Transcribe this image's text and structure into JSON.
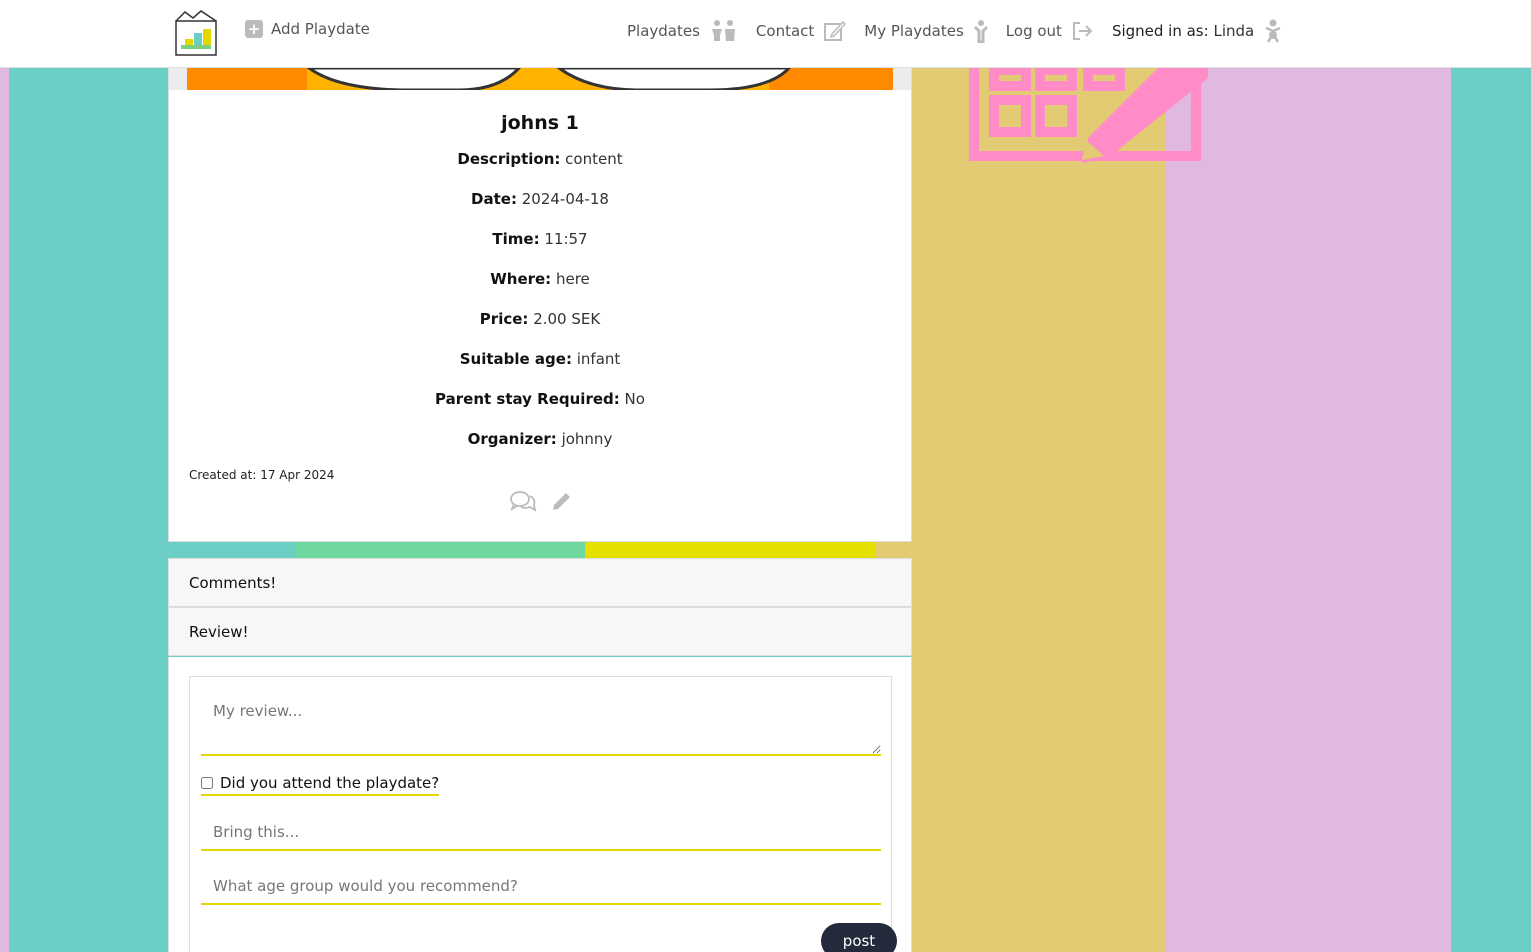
{
  "nav": {
    "add_label": "Add Playdate",
    "items": [
      {
        "label": "Playdates",
        "icon": "children-icon"
      },
      {
        "label": "Contact",
        "icon": "edit-icon"
      },
      {
        "label": "My Playdates",
        "icon": "child-icon"
      },
      {
        "label": "Log out",
        "icon": "logout-icon"
      }
    ],
    "signed_in_prefix": "Signed in as:",
    "signed_in_user": "Linda"
  },
  "playdate": {
    "title": "johns 1",
    "details": [
      {
        "label": "Description:",
        "value": "content"
      },
      {
        "label": "Date:",
        "value": "2024-04-18"
      },
      {
        "label": "Time:",
        "value": "11:57"
      },
      {
        "label": "Where:",
        "value": "here"
      },
      {
        "label": "Price:",
        "value": "2.00 SEK"
      },
      {
        "label": "Suitable age:",
        "value": "infant"
      },
      {
        "label": "Parent stay Required:",
        "value": "No"
      },
      {
        "label": "Organizer:",
        "value": "johnny"
      }
    ],
    "created_at": "Created at: 17 Apr 2024"
  },
  "accordion": {
    "comments": "Comments!",
    "review": "Review!"
  },
  "review_form": {
    "review_placeholder": "My review...",
    "attend_label": "Did you attend the playdate?",
    "bring_placeholder": "Bring this...",
    "age_placeholder": "What age group would you recommend?",
    "post_label": "post"
  },
  "colors": {
    "teal": "#6ccfc6",
    "gold": "#e2cb72",
    "purple": "#e0b8e0",
    "pink_icon": "#ff8cc6",
    "accent_yellow": "#e5d800",
    "post_button": "#222a3c"
  }
}
